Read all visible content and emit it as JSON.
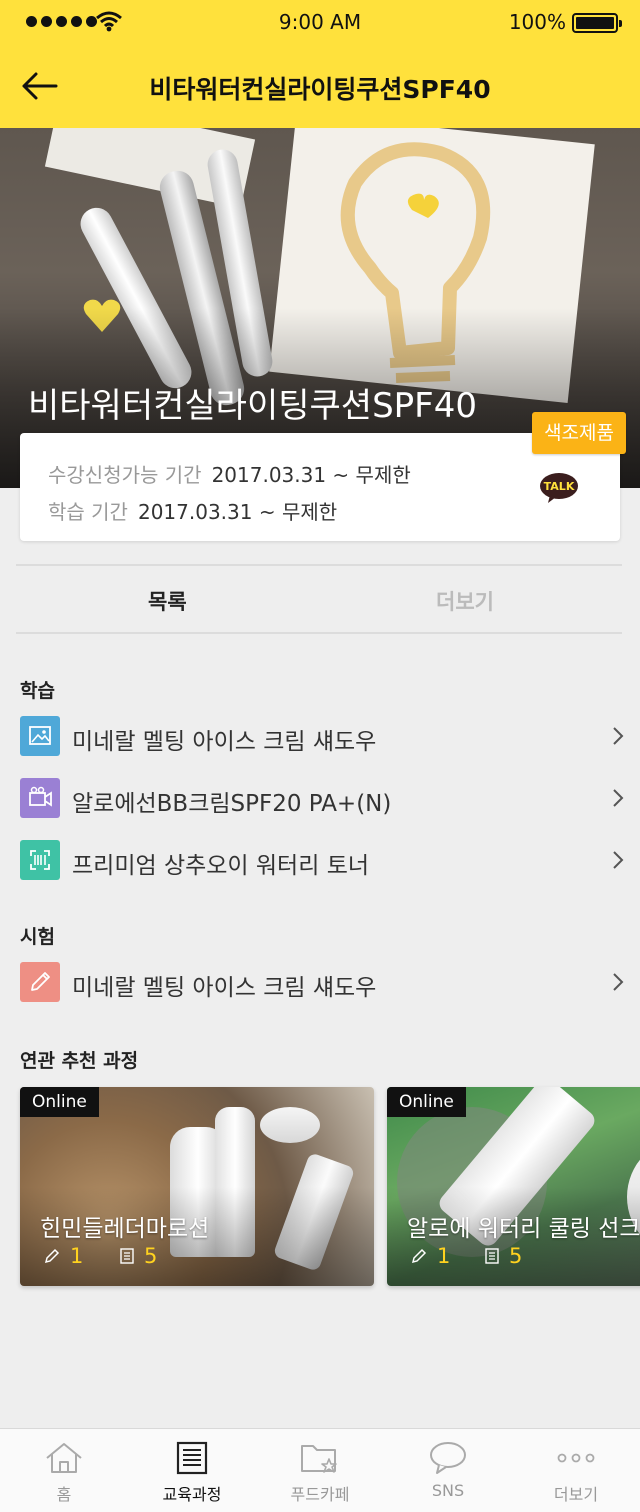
{
  "status_bar": {
    "time": "9:00 AM",
    "battery": "100%"
  },
  "nav": {
    "title": "비타워터컨실라이팅쿠션SPF40"
  },
  "hero": {
    "title": "비타워터컨실라이팅쿠션SPF40"
  },
  "info": {
    "badge": "색조제품",
    "enroll_label": "수강신청가능 기간",
    "enroll_value": "2017.03.31 ~ 무제한",
    "study_label": "학습 기간",
    "study_value": "2017.03.31 ~ 무제한",
    "talk_label": "TALK"
  },
  "tabs": {
    "active": "목록",
    "inactive": "더보기"
  },
  "sections": {
    "study": "학습",
    "exam": "시험",
    "related": "연관 추천 과정"
  },
  "study_items": [
    {
      "label": "미네랄 멜팅 아이스 크림 섀도우",
      "icon": "image-icon",
      "color": "#4fa8d8"
    },
    {
      "label": "알로에선BB크림SPF20 PA+(N)",
      "icon": "video-camera-icon",
      "color": "#9a80d4"
    },
    {
      "label": "프리미엄 상추오이 워터리 토너",
      "icon": "scan-icon",
      "color": "#3fc2a5"
    }
  ],
  "exam_items": [
    {
      "label": "미네랄 멜팅 아이스 크림 섀도우",
      "icon": "pencil-icon",
      "color": "#ee8f84"
    }
  ],
  "recommended": [
    {
      "tag": "Online",
      "title": "힌민들레더마로션",
      "exam_count": "1",
      "doc_count": "5"
    },
    {
      "tag": "Online",
      "title": "알로에 워터리 쿨링 선크",
      "exam_count": "1",
      "doc_count": "5"
    }
  ],
  "tabbar": [
    {
      "label": "홈",
      "icon": "home-icon"
    },
    {
      "label": "교육과정",
      "icon": "document-icon"
    },
    {
      "label": "푸드카페",
      "icon": "folder-star-icon"
    },
    {
      "label": "SNS",
      "icon": "chat-bubble-icon"
    },
    {
      "label": "더보기",
      "icon": "more-dots-icon"
    }
  ],
  "colors": {
    "brand": "#ffe13c",
    "badge": "#fbb316",
    "accent_text": "#ffd21f"
  }
}
